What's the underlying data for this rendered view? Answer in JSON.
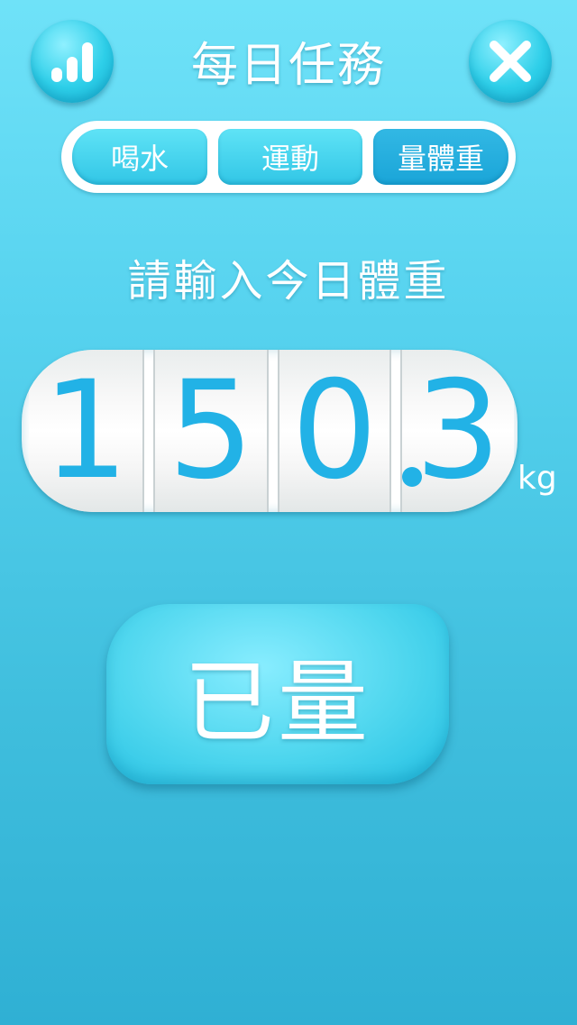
{
  "header": {
    "title": "每日任務",
    "stats_icon": "bar-chart-icon",
    "close_icon": "close-icon"
  },
  "tabs": [
    {
      "label": "喝水"
    },
    {
      "label": "運動"
    },
    {
      "label": "量體重",
      "selected": true
    }
  ],
  "prompt": "請輸入今日體重",
  "weight": {
    "digits": [
      "1",
      "5",
      "0",
      "3"
    ],
    "display": "150.3",
    "unit": "kg"
  },
  "action": {
    "label": "已量"
  },
  "colors": {
    "background_top": "#6fe2f8",
    "background_bottom": "#2fb0d4",
    "accent": "#22b2e6",
    "selected_tab": "#1aa5d8"
  }
}
